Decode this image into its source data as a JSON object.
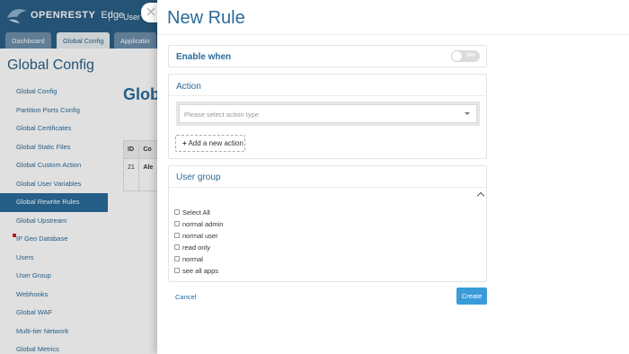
{
  "app": {
    "logo_text": "OPENRESTY",
    "logo_sub": "Edge",
    "separator": "|",
    "user_label": "User M",
    "nav_tabs": [
      {
        "label": "Dashboard"
      },
      {
        "label": "Global Config"
      },
      {
        "label": "Applicatio"
      }
    ],
    "section_title": "Global Config",
    "sidebar": [
      {
        "label": "Global Config"
      },
      {
        "label": "Partition Ports Config"
      },
      {
        "label": "Global Certificates"
      },
      {
        "label": "Global Static Files"
      },
      {
        "label": "Global Custom Action"
      },
      {
        "label": "Global User Variables"
      },
      {
        "label": "Global Rewrite Rules"
      },
      {
        "label": "Global Upstream"
      },
      {
        "label": "IP Geo Database"
      },
      {
        "label": "Users"
      },
      {
        "label": "User Group"
      },
      {
        "label": "Webhooks"
      },
      {
        "label": "Global WAF"
      },
      {
        "label": "Multi-tier Network"
      },
      {
        "label": "Global Metrics"
      }
    ],
    "main_title": "Glob",
    "table": {
      "header": [
        "ID",
        "Co"
      ],
      "rows": [
        [
          "21",
          "Ale"
        ]
      ]
    }
  },
  "drawer": {
    "close_glyph": "×",
    "title": "New Rule",
    "enable_when": {
      "label": "Enable when",
      "toggle_text": "OFF",
      "on": false
    },
    "action": {
      "label": "Action",
      "select_placeholder": "Please select action type",
      "add_label": "Add a new action",
      "add_glyph": "+"
    },
    "user_group": {
      "label": "User group",
      "options": [
        {
          "label": "Select All",
          "checked": false
        },
        {
          "label": "normal admin",
          "checked": false
        },
        {
          "label": "normal user",
          "checked": false
        },
        {
          "label": "read only",
          "checked": false
        },
        {
          "label": "normal",
          "checked": false
        },
        {
          "label": "see all apps",
          "checked": false
        }
      ]
    },
    "cancel_label": "Cancel",
    "create_label": "Create"
  },
  "colors": {
    "brand": "#2b5f86",
    "accent": "#2b6b9a",
    "primary_button": "#3a9bd9"
  }
}
